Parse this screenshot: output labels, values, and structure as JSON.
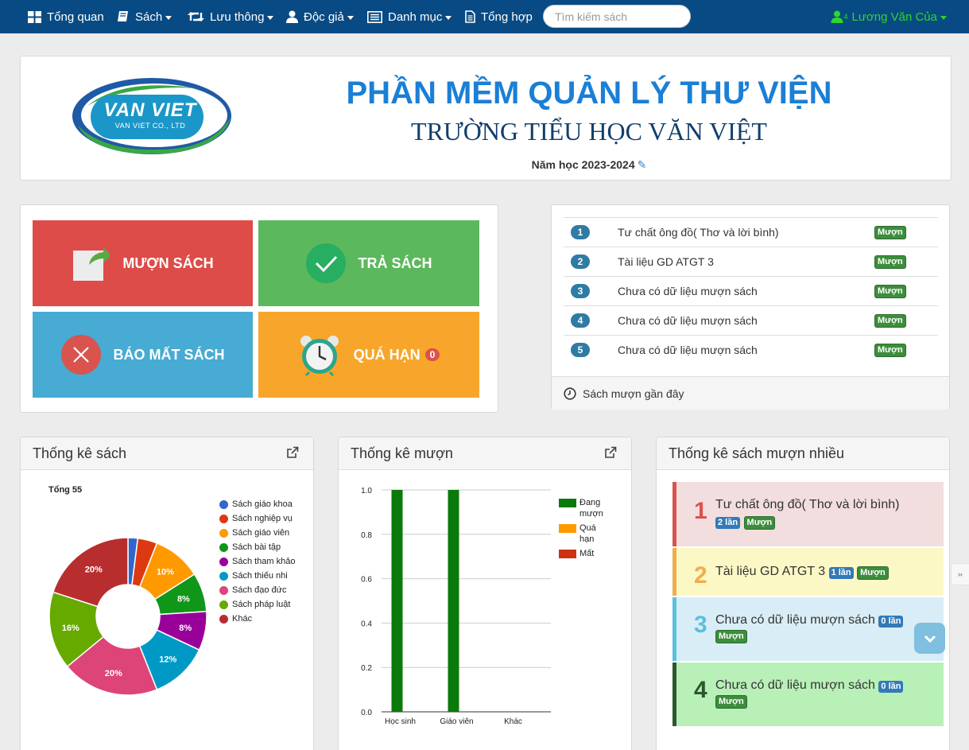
{
  "nav": {
    "items": [
      {
        "label": "Tổng quan",
        "icon": "grid-icon"
      },
      {
        "label": "Sách",
        "icon": "book-icon",
        "dropdown": true
      },
      {
        "label": "Lưu thông",
        "icon": "retweet-icon",
        "dropdown": true
      },
      {
        "label": "Độc giả",
        "icon": "user-icon",
        "dropdown": true
      },
      {
        "label": "Danh mục",
        "icon": "list-icon",
        "dropdown": true
      },
      {
        "label": "Tổng hợp",
        "icon": "file-icon"
      }
    ],
    "search_placeholder": "Tìm kiếm sách",
    "user_name": "Lương Văn Của",
    "user_badge": "4"
  },
  "header": {
    "logo_text": "VAN VIET",
    "logo_subtext": "VAN VIET CO., LTD",
    "title": "PHẦN MỀM QUẢN LÝ THƯ VIỆN",
    "subtitle": "TRƯỜNG TIỂU HỌC VĂN VIỆT",
    "school_year": "Năm học 2023-2024"
  },
  "tiles": {
    "borrow": "MƯỢN SÁCH",
    "return": "TRẢ SÁCH",
    "lost": "BÁO MẤT SÁCH",
    "overdue": "QUÁ HẠN",
    "overdue_count": "0"
  },
  "recent": {
    "rows": [
      {
        "num": "1",
        "title": "Tư chất ông đồ( Thơ và lời bình)",
        "status": "Mượn"
      },
      {
        "num": "2",
        "title": "Tài liệu GD ATGT 3",
        "status": "Mượn"
      },
      {
        "num": "3",
        "title": "Chưa có dữ liệu mượn sách",
        "status": "Mượn"
      },
      {
        "num": "4",
        "title": "Chưa có dữ liệu mượn sách",
        "status": "Mượn"
      },
      {
        "num": "5",
        "title": "Chưa có dữ liệu mượn sách",
        "status": "Mượn"
      }
    ],
    "footer": "Sách mượn gần đây"
  },
  "stats": {
    "books_title": "Thống kê sách",
    "borrow_title": "Thống kê mượn",
    "top_title": "Thống kê sách mượn nhiều"
  },
  "top_books": [
    {
      "rank": "1",
      "title": "Tư chất ông đồ( Thơ và lời bình)",
      "count": "2 lần",
      "status": "Mượn"
    },
    {
      "rank": "2",
      "title": "Tài liệu GD ATGT 3",
      "count": "1 lần",
      "status": "Mượn"
    },
    {
      "rank": "3",
      "title": "Chưa có dữ liệu mượn sách",
      "count": "0 lần",
      "status": "Mượn"
    },
    {
      "rank": "4",
      "title": "Chưa có dữ liệu mượn sách",
      "count": "0 lần",
      "status": "Mượn"
    }
  ],
  "side_tab": "›‹",
  "chart_data": [
    {
      "type": "pie",
      "title": "Tổng 55",
      "categories": [
        "Sách giáo khoa",
        "Sách nghiệp vụ",
        "Sách giáo viên",
        "Sách bài tập",
        "Sách tham khảo",
        "Sách thiếu nhi",
        "Sách đạo đức",
        "Sách pháp luật",
        "Khác"
      ],
      "values": [
        2,
        4,
        10,
        8,
        8,
        12,
        20,
        16,
        20
      ],
      "value_labels": [
        "",
        "",
        "10%",
        "8%",
        "8%",
        "12%",
        "20%",
        "16%",
        "20%"
      ],
      "colors": [
        "#3366cc",
        "#dc3912",
        "#ff9900",
        "#109618",
        "#990099",
        "#0099c6",
        "#dd4477",
        "#66aa00",
        "#b82e2e"
      ],
      "legend_position": "right"
    },
    {
      "type": "bar",
      "categories": [
        "Học sinh",
        "Giáo viên",
        "Khác"
      ],
      "series": [
        {
          "name": "Đang mượn",
          "values": [
            1.0,
            1.0,
            0
          ],
          "color": "#0a7a0a"
        },
        {
          "name": "Quá hạn",
          "values": [
            0,
            0,
            0
          ],
          "color": "#ff9900"
        },
        {
          "name": "Mất",
          "values": [
            0,
            0,
            0
          ],
          "color": "#cc3311"
        }
      ],
      "yticks": [
        "0.0",
        "0.2",
        "0.4",
        "0.6",
        "0.8",
        "1.0"
      ],
      "ylim": [
        0,
        1.0
      ],
      "grid": true,
      "legend_position": "right"
    }
  ]
}
